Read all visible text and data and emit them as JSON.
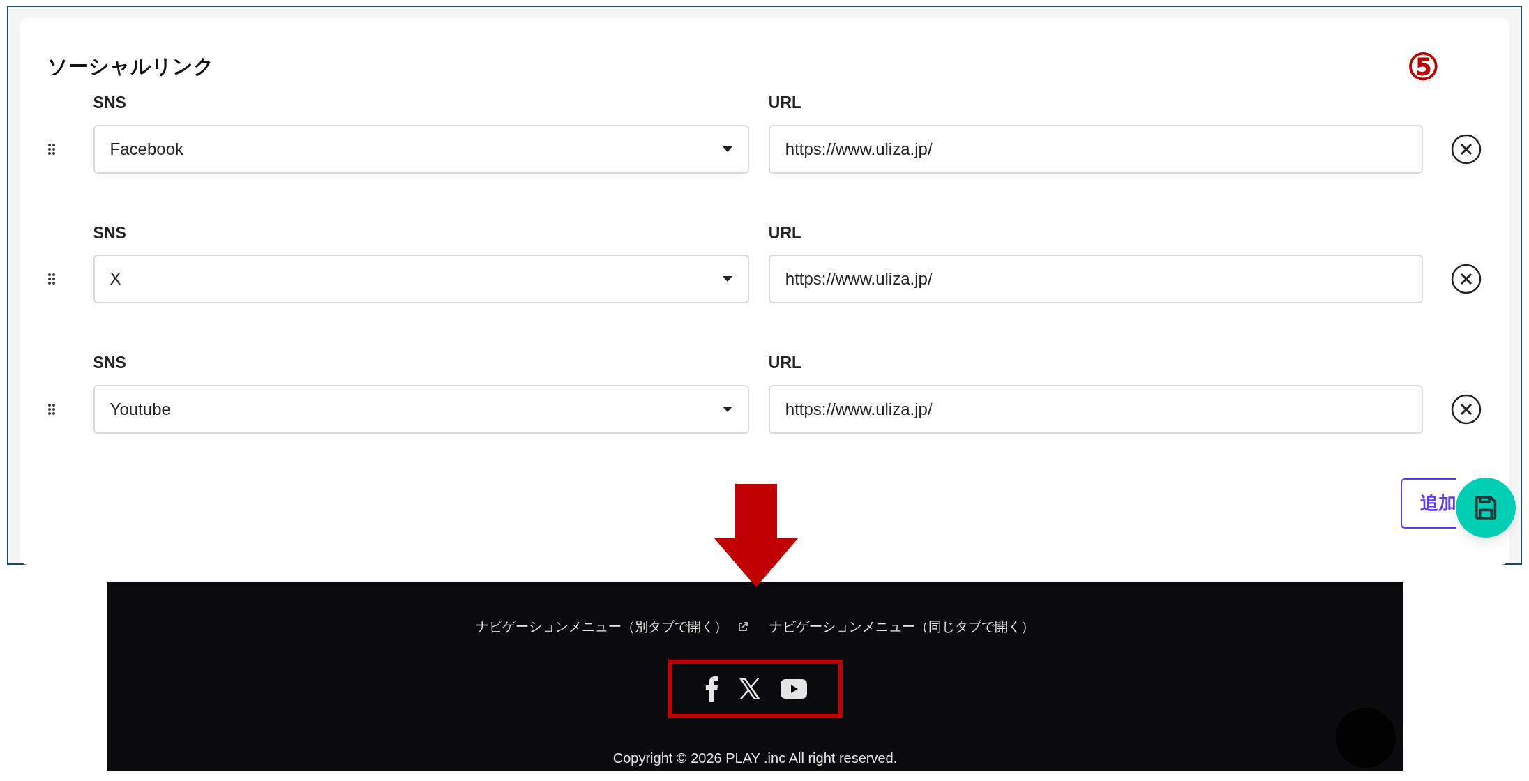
{
  "section": {
    "title": "ソーシャルリンク",
    "annotation": "⑤"
  },
  "rows": [
    {
      "sns_label": "SNS",
      "sns": "Facebook",
      "url_label": "URL",
      "url": "https://www.uliza.jp/"
    },
    {
      "sns_label": "SNS",
      "sns": "X",
      "url_label": "URL",
      "url": "https://www.uliza.jp/"
    },
    {
      "sns_label": "SNS",
      "sns": "Youtube",
      "url_label": "URL",
      "url": "https://www.uliza.jp/"
    }
  ],
  "add_button": "追加",
  "footer": {
    "links": [
      {
        "label": "ナビゲーションメニュー（別タブで開く）",
        "external": true
      },
      {
        "label": "ナビゲーションメニュー（同じタブで開く）",
        "external": false
      }
    ],
    "social": [
      {
        "kind": "facebook"
      },
      {
        "kind": "x"
      },
      {
        "kind": "youtube"
      }
    ],
    "copyright": "Copyright © 2026 PLAY .inc All right reserved."
  }
}
